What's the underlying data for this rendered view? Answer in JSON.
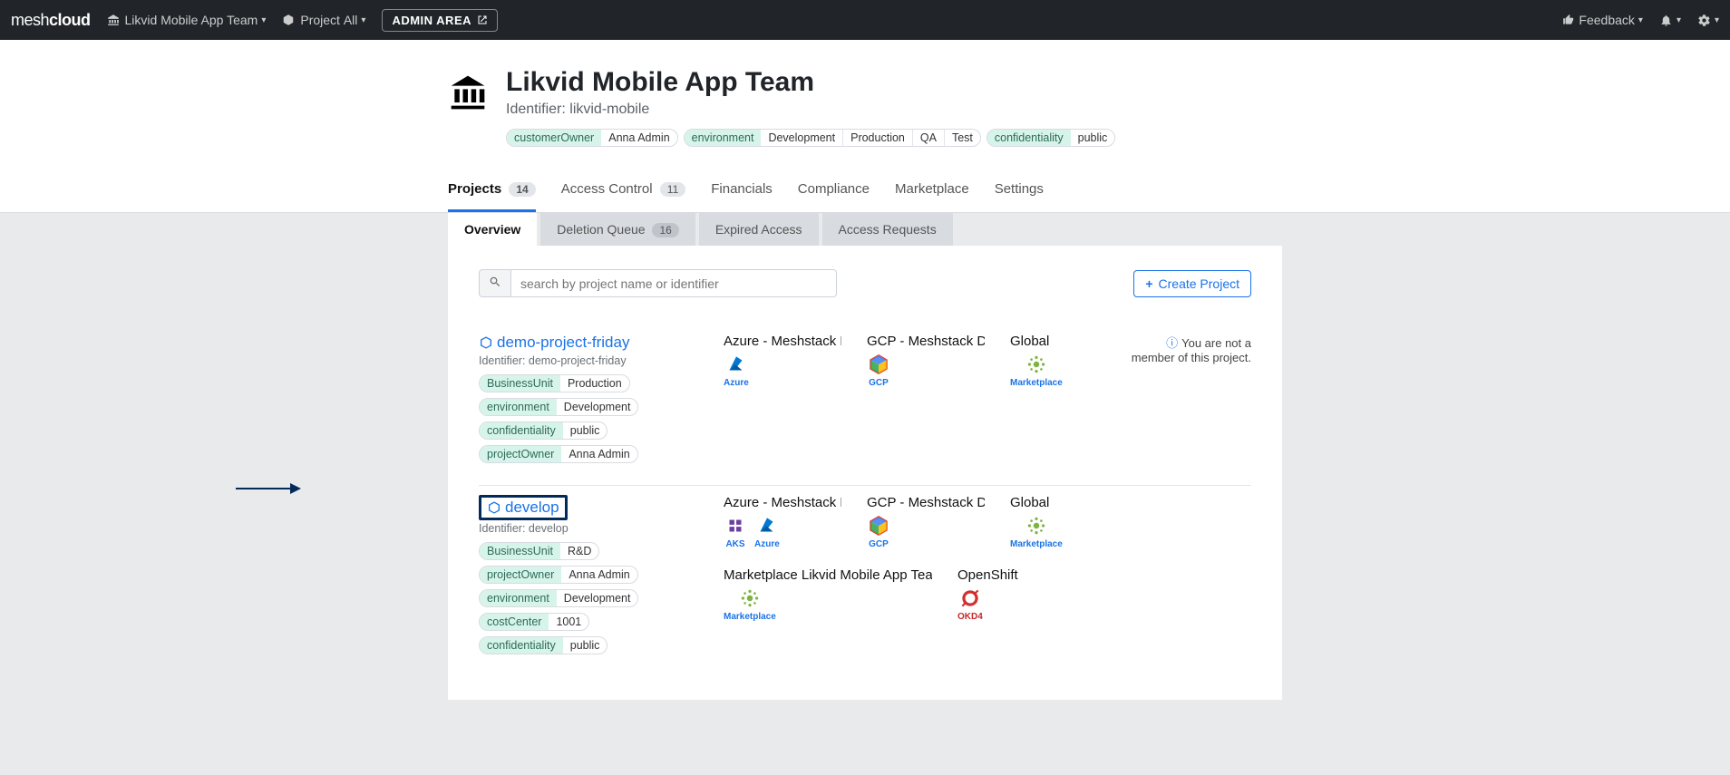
{
  "nav": {
    "brand_light": "mesh",
    "brand_bold": "cloud",
    "team_selector": "Likvid Mobile App Team",
    "project_label": "Project",
    "project_value": "All",
    "admin_area": "ADMIN AREA",
    "feedback": "Feedback"
  },
  "header": {
    "title": "Likvid Mobile App Team",
    "identifier_label": "Identifier: likvid-mobile",
    "tags": [
      {
        "key": "customerOwner",
        "vals": [
          "Anna Admin"
        ]
      },
      {
        "key": "environment",
        "vals": [
          "Development",
          "Production",
          "QA",
          "Test"
        ]
      },
      {
        "key": "confidentiality",
        "vals": [
          "public"
        ]
      }
    ]
  },
  "tabs": {
    "projects": "Projects",
    "projects_count": "14",
    "access_control": "Access Control",
    "access_control_count": "11",
    "financials": "Financials",
    "compliance": "Compliance",
    "marketplace": "Marketplace",
    "settings": "Settings"
  },
  "subtabs": {
    "overview": "Overview",
    "deletion_queue": "Deletion Queue",
    "deletion_queue_count": "16",
    "expired_access": "Expired Access",
    "access_requests": "Access Requests"
  },
  "panel": {
    "search_placeholder": "search by project name or identifier",
    "create_project": "Create Project",
    "not_member_msg": "You are not a member of this project."
  },
  "projects": [
    {
      "name": "demo-project-friday",
      "identifier": "Identifier: demo-project-friday",
      "tags": [
        {
          "key": "BusinessUnit",
          "vals": [
            "Production"
          ]
        },
        {
          "key": "environment",
          "vals": [
            "Development"
          ]
        },
        {
          "key": "confidentiality",
          "vals": [
            "public"
          ]
        },
        {
          "key": "projectOwner",
          "vals": [
            "Anna Admin"
          ]
        }
      ],
      "platforms": [
        {
          "title": "Azure - Meshstack Dev",
          "icons": [
            {
              "svg": "azure",
              "label": "Azure"
            }
          ]
        },
        {
          "title": "GCP - Meshstack Dev",
          "icons": [
            {
              "svg": "gcp",
              "label": "GCP"
            }
          ]
        },
        {
          "title": "Global",
          "icons": [
            {
              "svg": "marketplace",
              "label": "Marketplace"
            }
          ]
        }
      ],
      "show_not_member": true
    },
    {
      "name": "develop",
      "identifier": "Identifier: develop",
      "highlighted": true,
      "tags": [
        {
          "key": "BusinessUnit",
          "vals": [
            "R&D"
          ]
        },
        {
          "key": "projectOwner",
          "vals": [
            "Anna Admin"
          ]
        },
        {
          "key": "environment",
          "vals": [
            "Development"
          ]
        },
        {
          "key": "costCenter",
          "vals": [
            "1001"
          ]
        },
        {
          "key": "confidentiality",
          "vals": [
            "public"
          ]
        }
      ],
      "platforms": [
        {
          "title": "Azure - Meshstack Dev",
          "icons": [
            {
              "svg": "aks",
              "label": "AKS"
            },
            {
              "svg": "azure",
              "label": "Azure"
            }
          ]
        },
        {
          "title": "GCP - Meshstack Dev",
          "icons": [
            {
              "svg": "gcp",
              "label": "GCP"
            }
          ]
        },
        {
          "title": "Global",
          "icons": [
            {
              "svg": "marketplace",
              "label": "Marketplace"
            }
          ]
        },
        {
          "title": "Marketplace Likvid Mobile App Team",
          "wide": true,
          "icons": [
            {
              "svg": "marketplace",
              "label": "Marketplace"
            }
          ]
        },
        {
          "title": "OpenShift",
          "icons": [
            {
              "svg": "okd",
              "label": "OKD4",
              "red": true
            }
          ]
        }
      ]
    }
  ]
}
